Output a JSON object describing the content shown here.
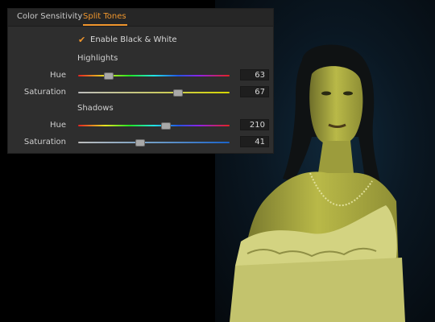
{
  "tabs": [
    {
      "label": "Color Sensitivity",
      "active": false
    },
    {
      "label": "Split Tones",
      "active": true
    }
  ],
  "enable_bw": {
    "label": "Enable Black & White",
    "checked": true
  },
  "highlights": {
    "title": "Highlights",
    "hue": {
      "label": "Hue",
      "value": "63",
      "min": 0,
      "max": 360
    },
    "saturation": {
      "label": "Saturation",
      "value": "67",
      "min": 0,
      "max": 100
    }
  },
  "shadows": {
    "title": "Shadows",
    "hue": {
      "label": "Hue",
      "value": "210",
      "min": 0,
      "max": 360
    },
    "saturation": {
      "label": "Saturation",
      "value": "41",
      "min": 0,
      "max": 100
    }
  },
  "colors": {
    "accent": "#f0962d",
    "panel": "#2e2e2e"
  },
  "icons": {
    "check": "checkmark-icon"
  }
}
